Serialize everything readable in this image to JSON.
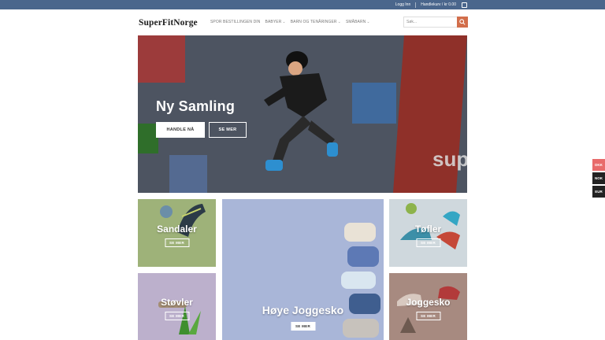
{
  "topbar": {
    "login": "Logg Inn",
    "cart": "Handlekurv / kr 0.00"
  },
  "header": {
    "logo": "SuperFitNorge",
    "nav": [
      {
        "label": "SPOR BESTILLINGEN DIN",
        "has_dropdown": false
      },
      {
        "label": "BABYER",
        "has_dropdown": true
      },
      {
        "label": "BARN OG TENÅRINGER",
        "has_dropdown": true
      },
      {
        "label": "SMÅBARN",
        "has_dropdown": true
      }
    ],
    "search_placeholder": "Søk..."
  },
  "hero": {
    "title": "Ny Samling",
    "shop_button": "HANDLE NÅ",
    "more_button": "SE MER",
    "brand_text": "sup"
  },
  "tiles": {
    "sandaler": {
      "title": "Sandaler",
      "button": "SE MER"
    },
    "joggesko_high": {
      "title": "Høye Joggesko",
      "button": "SE MER"
    },
    "tofler": {
      "title": "Tøfler",
      "button": "SE MER"
    },
    "stovler": {
      "title": "Støvler",
      "button": "SE MER"
    },
    "joggesko": {
      "title": "Joggesko",
      "button": "SE MER"
    }
  },
  "currency": [
    "DKK",
    "NOK",
    "EUR"
  ],
  "colors": {
    "topbar": "#4a668c",
    "accent": "#d26e4b"
  }
}
